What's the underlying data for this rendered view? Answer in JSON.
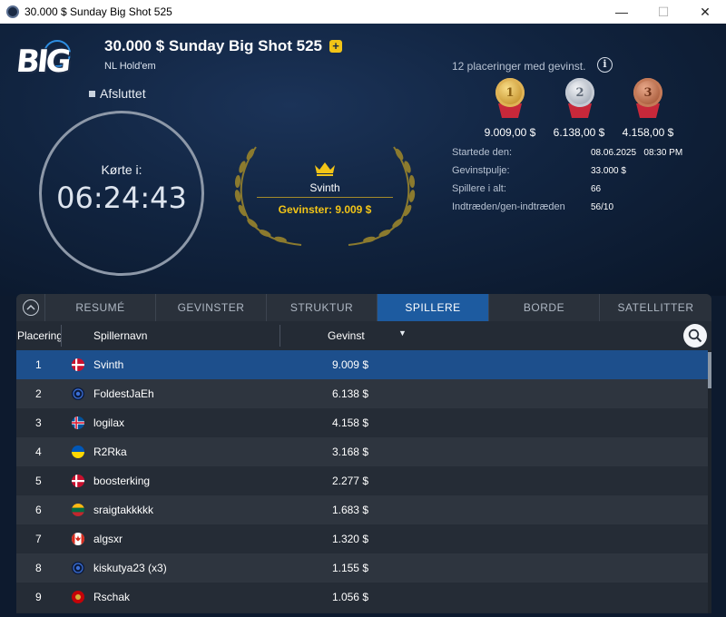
{
  "window": {
    "title": "30.000 $ Sunday Big Shot 525",
    "controls": {
      "minimize": "—",
      "maximize": "☐",
      "close": "✕"
    }
  },
  "header": {
    "logo_text": "BIG",
    "tournament_title": "30.000 $ Sunday Big Shot 525",
    "plus_label": "+",
    "game_type": "NL Hold'em",
    "status": "Afsluttet",
    "clock": {
      "label": "Kørte i:",
      "value": "06:24:43"
    },
    "winner": {
      "name": "Svinth",
      "prize_text": "Gevinster: 9.009 $"
    },
    "paid_places": "12 placeringer med gevinst.",
    "info_label": "i",
    "medals": [
      {
        "rank": "1",
        "amount": "9.009,00 $"
      },
      {
        "rank": "2",
        "amount": "6.138,00 $"
      },
      {
        "rank": "3",
        "amount": "4.158,00 $"
      }
    ],
    "stats": [
      {
        "label": "Startede den:",
        "value": "08.06.2025   08:30 PM"
      },
      {
        "label": "Gevinstpulje:",
        "value": "33.000 $"
      },
      {
        "label": "Spillere i alt:",
        "value": "66"
      },
      {
        "label": "Indtræden/gen-indtræden",
        "value": "56/10"
      }
    ]
  },
  "tabs": {
    "items": [
      "RESUMÉ",
      "GEVINSTER",
      "STRUKTUR",
      "SPILLERE",
      "BORDE",
      "SATELLITTER"
    ],
    "active": "SPILLERE"
  },
  "table": {
    "headers": {
      "place": "Placering",
      "name": "Spillernavn",
      "prize": "Gevinst"
    },
    "sort_indicator": "▼",
    "rows": [
      {
        "place": "1",
        "flag": "denmark",
        "name": "Svinth",
        "prize": "9.009 $"
      },
      {
        "place": "2",
        "flag": "anonymous",
        "name": "FoldestJaEh",
        "prize": "6.138 $"
      },
      {
        "place": "3",
        "flag": "iceland",
        "name": "logilax",
        "prize": "4.158 $"
      },
      {
        "place": "4",
        "flag": "ukraine",
        "name": "R2Rka",
        "prize": "3.168 $"
      },
      {
        "place": "5",
        "flag": "denmark",
        "name": "boosterking",
        "prize": "2.277 $"
      },
      {
        "place": "6",
        "flag": "lithuania",
        "name": "sraigtakkkkk",
        "prize": "1.683 $"
      },
      {
        "place": "7",
        "flag": "canada",
        "name": "algsxr",
        "prize": "1.320 $"
      },
      {
        "place": "8",
        "flag": "anonymous",
        "name": "kiskutya23 (x3)",
        "prize": "1.155 $"
      },
      {
        "place": "9",
        "flag": "montenegro",
        "name": "Rschak",
        "prize": "1.056 $"
      }
    ],
    "selected_index": 0
  },
  "colors": {
    "accent_blue": "#1d5ba0",
    "gold": "#f2c417",
    "panel_bg": "#242b35"
  }
}
